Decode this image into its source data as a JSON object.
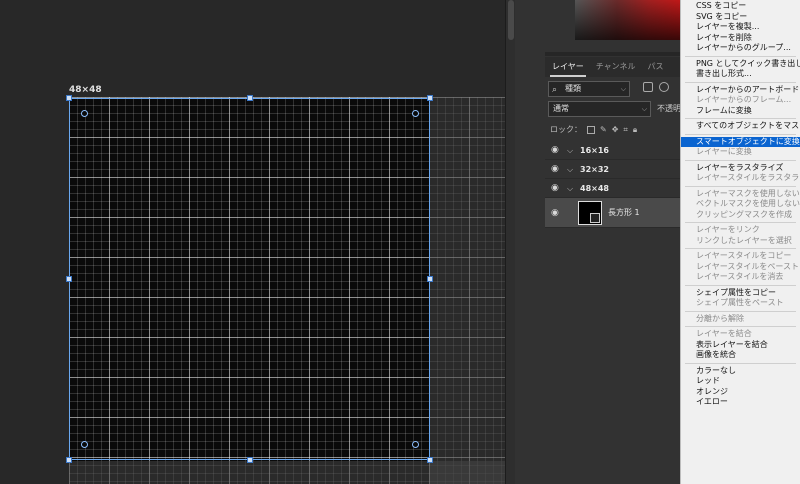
{
  "canvas": {
    "doc_label": "48×48"
  },
  "panel": {
    "tabs": [
      {
        "label": "レイヤー",
        "active": true
      },
      {
        "label": "チャンネル",
        "active": false
      },
      {
        "label": "パス",
        "active": false
      }
    ],
    "filter_label": "種類",
    "blend_mode": "通常",
    "opacity_label": "不透明",
    "lock_label": "ロック：",
    "layers": [
      {
        "name": "16×16",
        "type": "group"
      },
      {
        "name": "32×32",
        "type": "group"
      },
      {
        "name": "48×48",
        "type": "group"
      },
      {
        "name": "長方形 1",
        "type": "shape"
      }
    ]
  },
  "menu": {
    "items": [
      {
        "label": "CSS をコピー",
        "state": "enabled"
      },
      {
        "label": "SVG をコピー",
        "state": "enabled"
      },
      {
        "label": "レイヤーを複製...",
        "state": "enabled"
      },
      {
        "label": "レイヤーを削除",
        "state": "enabled"
      },
      {
        "label": "レイヤーからのグループ...",
        "state": "enabled"
      },
      {
        "sep": true
      },
      {
        "label": "PNG としてクイック書き出し",
        "state": "enabled"
      },
      {
        "label": "書き出し形式...",
        "state": "enabled"
      },
      {
        "sep": true
      },
      {
        "label": "レイヤーからのアートボード...",
        "state": "enabled"
      },
      {
        "label": "レイヤーからのフレーム...",
        "state": "disabled"
      },
      {
        "label": "フレームに変換",
        "state": "enabled"
      },
      {
        "sep": true
      },
      {
        "label": "すべてのオブジェクトをマスク",
        "state": "enabled"
      },
      {
        "sep": true
      },
      {
        "label": "スマートオブジェクトに変換",
        "state": "highlighted"
      },
      {
        "label": "レイヤーに変換",
        "state": "disabled"
      },
      {
        "sep": true
      },
      {
        "label": "レイヤーをラスタライズ",
        "state": "enabled"
      },
      {
        "label": "レイヤースタイルをラスタライズ",
        "state": "disabled"
      },
      {
        "sep": true
      },
      {
        "label": "レイヤーマスクを使用しない",
        "state": "disabled"
      },
      {
        "label": "ベクトルマスクを使用しない",
        "state": "disabled"
      },
      {
        "label": "クリッピングマスクを作成",
        "state": "disabled"
      },
      {
        "sep": true
      },
      {
        "label": "レイヤーをリンク",
        "state": "disabled"
      },
      {
        "label": "リンクしたレイヤーを選択",
        "state": "disabled"
      },
      {
        "sep": true
      },
      {
        "label": "レイヤースタイルをコピー",
        "state": "disabled"
      },
      {
        "label": "レイヤースタイルをペースト",
        "state": "disabled"
      },
      {
        "label": "レイヤースタイルを消去",
        "state": "disabled"
      },
      {
        "sep": true
      },
      {
        "label": "シェイプ属性をコピー",
        "state": "enabled"
      },
      {
        "label": "シェイプ属性をペースト",
        "state": "disabled"
      },
      {
        "sep": true
      },
      {
        "label": "分離から解除",
        "state": "disabled"
      },
      {
        "sep": true
      },
      {
        "label": "レイヤーを結合",
        "state": "disabled"
      },
      {
        "label": "表示レイヤーを結合",
        "state": "enabled"
      },
      {
        "label": "画像を統合",
        "state": "enabled"
      },
      {
        "sep": true
      },
      {
        "label": "カラーなし",
        "state": "enabled"
      },
      {
        "label": "レッド",
        "state": "enabled"
      },
      {
        "label": "オレンジ",
        "state": "enabled"
      },
      {
        "label": "イエロー",
        "state": "enabled"
      }
    ]
  }
}
